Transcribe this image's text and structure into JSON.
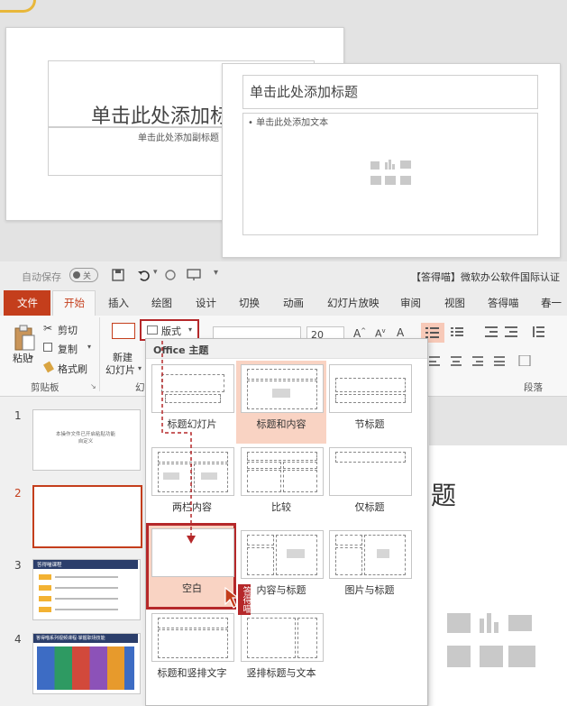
{
  "top_preview": {
    "slide1_title_placeholder": "单击此处添加标",
    "slide1_subtitle_placeholder": "单击此处添加副标题",
    "slide2_title_placeholder": "单击此处添加标题",
    "slide2_body_placeholder": "• 单击此处添加文本"
  },
  "quick_access": {
    "autosave_label": "自动保存",
    "autosave_state": "关",
    "doc_title": "【答得喵】微软办公软件国际认证"
  },
  "tabs": [
    "文件",
    "开始",
    "插入",
    "绘图",
    "设计",
    "切换",
    "动画",
    "幻灯片放映",
    "审阅",
    "视图",
    "答得喵",
    "春一"
  ],
  "active_tab": "开始",
  "ribbon": {
    "paste": "粘贴",
    "cut": "剪切",
    "copy": "复制",
    "format_painter": "格式刷",
    "new_slide": "新建",
    "new_slide2": "幻灯片",
    "layout": "版式",
    "font_size": "20",
    "clipboard_group": "剪贴板",
    "slides_group_partial": "幻",
    "paragraph_group": "段落"
  },
  "thumbnails": {
    "numbers": [
      "1",
      "2",
      "3",
      "4"
    ],
    "slide1_text_line1": "本操作文件已开启粘贴功能",
    "slide1_text_line2": "自定义",
    "slide3_header": "答得喵课程",
    "slide4_header": "答得喵系列视频课程·掌握职场技能"
  },
  "layout_menu": {
    "heading": "Office 主题",
    "items": [
      "标题幻灯片",
      "标题和内容",
      "节标题",
      "两栏内容",
      "比较",
      "仅标题",
      "空白",
      "内容与标题",
      "图片与标题",
      "标题和竖排文字",
      "竖排标题与文本"
    ],
    "selected": "标题和内容",
    "highlighted": "空白"
  },
  "background_slide_title_partial": "题",
  "watermark": "答得喵",
  "colors": {
    "accent": "#c43e1c",
    "highlight_red": "#b5282a",
    "selected_fill": "#f9d3c3"
  }
}
